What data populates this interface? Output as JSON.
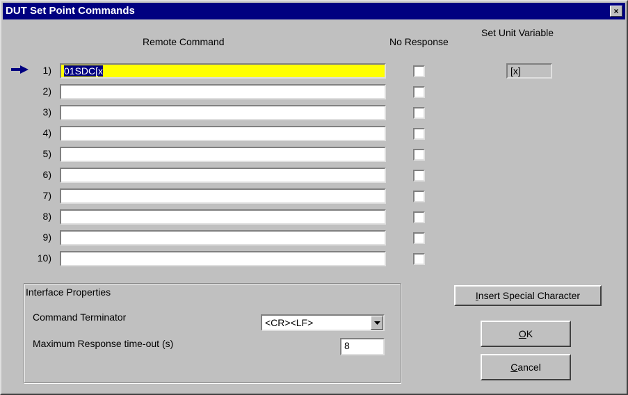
{
  "window": {
    "title": "DUT Set Point Commands",
    "close_glyph": "×"
  },
  "headers": {
    "remote_command": "Remote Command",
    "no_response": "No Response",
    "set_unit_variable": "Set Unit Variable"
  },
  "commands": [
    {
      "label": "1)",
      "value": "01SDC[x",
      "no_response": false
    },
    {
      "label": "2)",
      "value": "",
      "no_response": false
    },
    {
      "label": "3)",
      "value": "",
      "no_response": false
    },
    {
      "label": "4)",
      "value": "",
      "no_response": false
    },
    {
      "label": "5)",
      "value": "",
      "no_response": false
    },
    {
      "label": "6)",
      "value": "",
      "no_response": false
    },
    {
      "label": "7)",
      "value": "",
      "no_response": false
    },
    {
      "label": "8)",
      "value": "",
      "no_response": false
    },
    {
      "label": "9)",
      "value": "",
      "no_response": false
    },
    {
      "label": "10)",
      "value": "",
      "no_response": false
    }
  ],
  "set_unit_variable_value": "[x]",
  "interface": {
    "group_title": "Interface Properties",
    "terminator_label": "Command Terminator",
    "terminator_value": "<CR><LF>",
    "timeout_label": "Maximum Response time-out (s)",
    "timeout_value": "8"
  },
  "buttons": {
    "insert_special": {
      "accel": "I",
      "rest": "nsert Special Character"
    },
    "ok": {
      "accel": "O",
      "rest": "K"
    },
    "cancel": {
      "accel": "C",
      "rest": "ancel"
    }
  },
  "colors": {
    "title_bar": "#000080",
    "active_field": "#ffff00",
    "arrow": "#000080"
  },
  "icons": {
    "current_row": "arrow-right-icon",
    "dropdown": "chevron-down-icon",
    "close": "close-icon"
  }
}
